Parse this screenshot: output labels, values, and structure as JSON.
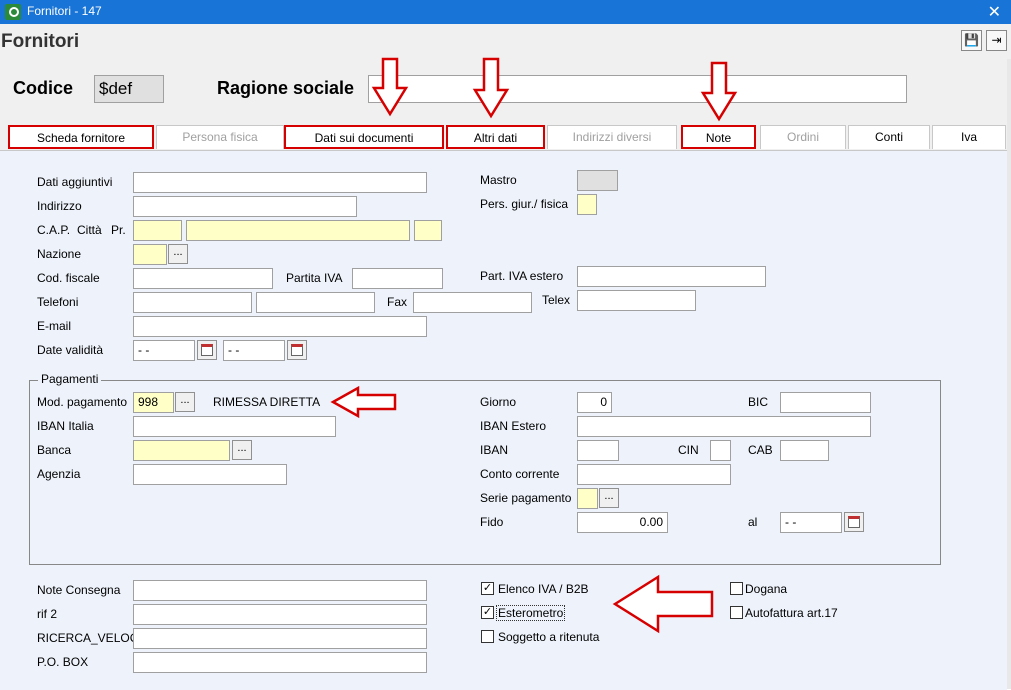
{
  "window": {
    "title": "Fornitori - 147",
    "close_glyph": "✕"
  },
  "form": {
    "title": "Fornitori"
  },
  "toolbar": {
    "save_glyph": "💾",
    "exit_glyph": "⇥"
  },
  "header": {
    "codice_label": "Codice",
    "codice_value": "$def",
    "ragione_label": "Ragione sociale",
    "ragione_value": ""
  },
  "tabs": [
    {
      "label": "Scheda fornitore"
    },
    {
      "label": "Persona fisica"
    },
    {
      "label": "Dati sui documenti"
    },
    {
      "label": "Altri dati"
    },
    {
      "label": "Indirizzi diversi"
    },
    {
      "label": "Note"
    },
    {
      "label": "Ordini"
    },
    {
      "label": "Conti"
    },
    {
      "label": "Iva"
    }
  ],
  "anagrafica": {
    "dati_aggiuntivi": "Dati aggiuntivi",
    "indirizzo": "Indirizzo",
    "cap": "C.A.P.",
    "citta": "Città",
    "pr": "Pr.",
    "nazione": "Nazione",
    "cod_fiscale": "Cod. fiscale",
    "partita_iva": "Partita IVA",
    "telefoni": "Telefoni",
    "fax": "Fax",
    "email": "E-mail",
    "date_validita": "Date validità",
    "date_from": "- -",
    "date_to": "- -",
    "mastro": "Mastro",
    "pers_giur": "Pers. giur./ fisica",
    "part_iva_estero": "Part. IVA estero",
    "telex": "Telex",
    "ellipsis": "..."
  },
  "pagamenti": {
    "group_title": "Pagamenti",
    "mod_pagamento": "Mod. pagamento",
    "mod_value": "998",
    "mod_desc": "RIMESSA DIRETTA",
    "iban_italia": "IBAN Italia",
    "banca": "Banca",
    "agenzia": "Agenzia",
    "giorno": "Giorno",
    "giorno_value": "0",
    "bic": "BIC",
    "iban_estero": "IBAN Estero",
    "iban": "IBAN",
    "cin": "CIN",
    "cab": "CAB",
    "conto_corrente": "Conto corrente",
    "serie_pagamento": "Serie pagamento",
    "fido": "Fido",
    "fido_value": "0.00",
    "al": "al",
    "al_value": "- -"
  },
  "bottom": {
    "note_consegna": "Note Consegna",
    "rif2": "rif 2",
    "ricerca_veloce": "RICERCA_VELOC",
    "po_box": "P.O. BOX",
    "elenco_iva": {
      "label": "Elenco IVA / B2B",
      "checked": true
    },
    "esterometro": {
      "label": "Esterometro",
      "checked": true
    },
    "soggetto_ritenuta": {
      "label": "Soggetto a ritenuta",
      "checked": false
    },
    "dogana": {
      "label": "Dogana",
      "checked": false
    },
    "autofattura": {
      "label": "Autofattura art.17",
      "checked": false
    },
    "check_glyph": "✓"
  }
}
